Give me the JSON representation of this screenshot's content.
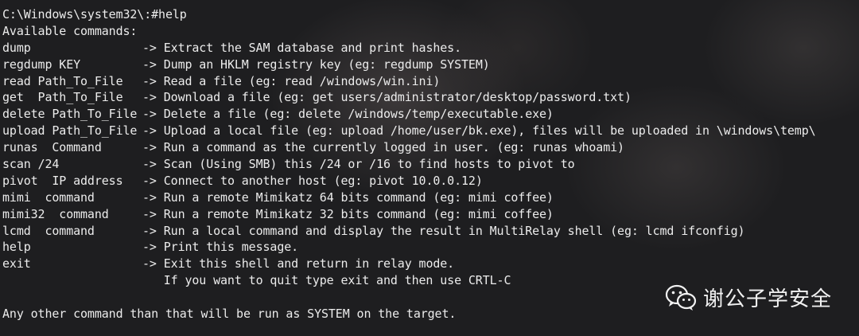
{
  "prompt_line": "C:\\Windows\\system32\\:#help",
  "header": "Available commands:",
  "arrow": "->",
  "commands": [
    {
      "cmd": "dump",
      "desc": "Extract the SAM database and print hashes."
    },
    {
      "cmd": "regdump KEY",
      "desc": "Dump an HKLM registry key (eg: regdump SYSTEM)"
    },
    {
      "cmd": "read Path_To_File",
      "desc": "Read a file (eg: read /windows/win.ini)"
    },
    {
      "cmd": "get  Path_To_File",
      "desc": "Download a file (eg: get users/administrator/desktop/password.txt)"
    },
    {
      "cmd": "delete Path_To_File",
      "desc": "Delete a file (eg: delete /windows/temp/executable.exe)"
    },
    {
      "cmd": "upload Path_To_File",
      "desc": "Upload a local file (eg: upload /home/user/bk.exe), files will be uploaded in \\windows\\temp\\"
    },
    {
      "cmd": "runas  Command",
      "desc": "Run a command as the currently logged in user. (eg: runas whoami)"
    },
    {
      "cmd": "scan /24",
      "desc": "Scan (Using SMB) this /24 or /16 to find hosts to pivot to"
    },
    {
      "cmd": "pivot  IP address",
      "desc": "Connect to another host (eg: pivot 10.0.0.12)"
    },
    {
      "cmd": "mimi  command",
      "desc": "Run a remote Mimikatz 64 bits command (eg: mimi coffee)"
    },
    {
      "cmd": "mimi32  command",
      "desc": "Run a remote Mimikatz 32 bits command (eg: mimi coffee)"
    },
    {
      "cmd": "lcmd  command",
      "desc": "Run a local command and display the result in MultiRelay shell (eg: lcmd ifconfig)"
    },
    {
      "cmd": "help",
      "desc": "Print this message."
    },
    {
      "cmd": "exit",
      "desc": "Exit this shell and return in relay mode."
    }
  ],
  "exit_note": "If you want to quit type exit and then use CRTL-C",
  "footer": "Any other command than that will be run as SYSTEM on the target.",
  "watermark": {
    "icon": "wechat-icon",
    "text": "谢公子学安全"
  }
}
